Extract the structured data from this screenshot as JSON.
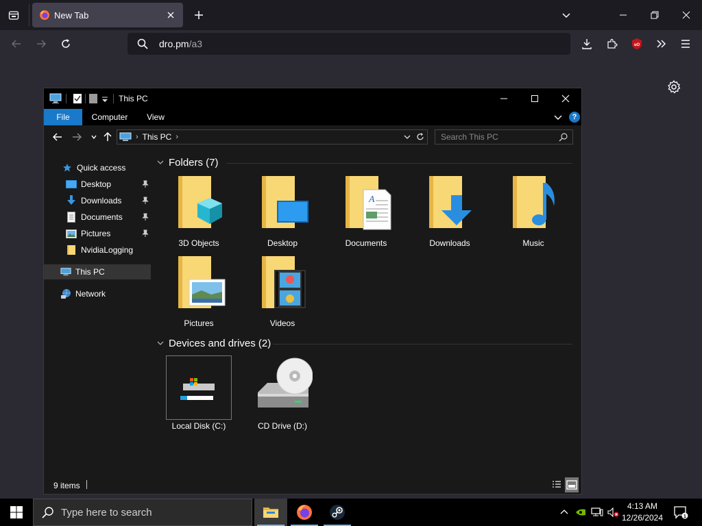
{
  "browser": {
    "tab_title": "New Tab",
    "url_host": "dro.pm",
    "url_path": "/a3"
  },
  "explorer": {
    "title": "This PC",
    "ribbon_tabs": [
      "File",
      "Computer",
      "View"
    ],
    "breadcrumb": "This PC",
    "search_placeholder": "Search This PC",
    "nav": {
      "quick_access": "Quick access",
      "items": [
        "Desktop",
        "Downloads",
        "Documents",
        "Pictures",
        "NvidiaLogging"
      ],
      "this_pc": "This PC",
      "network": "Network"
    },
    "folders_header": "Folders (7)",
    "folders": [
      "3D Objects",
      "Desktop",
      "Documents",
      "Downloads",
      "Music",
      "Pictures",
      "Videos"
    ],
    "drives_header": "Devices and drives (2)",
    "drives": [
      "Local Disk (C:)",
      "CD Drive (D:)"
    ],
    "status_count": "9 items"
  },
  "taskbar": {
    "search_placeholder": "Type here to search",
    "time": "4:13 AM",
    "date": "12/26/2024"
  },
  "colors": {
    "accent": "#1979ca",
    "folder": "#f2c862",
    "browser_bg": "#2b2a33"
  }
}
